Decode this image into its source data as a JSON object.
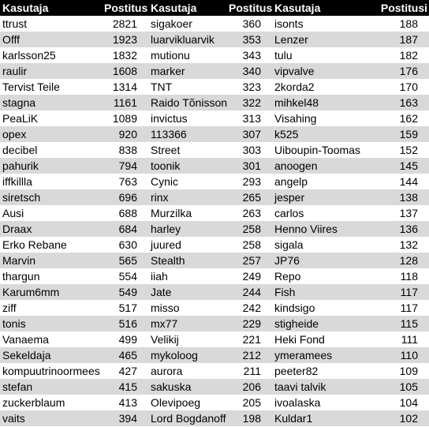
{
  "headers": [
    "Kasutaja",
    "Postitusi",
    "Kasutaja",
    "Postitusi",
    "Kasutaja",
    "Postitusi"
  ],
  "rows": [
    [
      "ttrust",
      "2821",
      "sigakoer",
      "360",
      "isonts",
      "188"
    ],
    [
      "Offf",
      "1923",
      "luarvikluarvik",
      "353",
      "Lenzer",
      "187"
    ],
    [
      "karlsson25",
      "1832",
      "mutionu",
      "343",
      "tulu",
      "182"
    ],
    [
      "raulir",
      "1608",
      "marker",
      "340",
      "vipvalve",
      "176"
    ],
    [
      "Tervist Teile",
      "1314",
      "TNT",
      "323",
      "2korda2",
      "170"
    ],
    [
      "stagna",
      "1161",
      "Raido Tõnisson",
      "322",
      "mihkel48",
      "163"
    ],
    [
      "PeaLiK",
      "1089",
      "invictus",
      "313",
      "Visahing",
      "162"
    ],
    [
      "opex",
      "920",
      "113366",
      "307",
      "k525",
      "159"
    ],
    [
      "decibel",
      "838",
      "Street",
      "303",
      "Uiboupin-Toomas",
      "152"
    ],
    [
      "pahurik",
      "794",
      "toonik",
      "301",
      "anoogen",
      "145"
    ],
    [
      "iffkillla",
      "763",
      "Cynic",
      "293",
      "angelp",
      "144"
    ],
    [
      "siretsch",
      "696",
      "rinx",
      "265",
      "jesper",
      "138"
    ],
    [
      "Ausi",
      "688",
      "Murzilka",
      "263",
      "carlos",
      "137"
    ],
    [
      "Draax",
      "684",
      "harley",
      "258",
      "Henno Viires",
      "136"
    ],
    [
      "Erko Rebane",
      "630",
      "juured",
      "258",
      "sigala",
      "132"
    ],
    [
      "Marvin",
      "565",
      "Stealth",
      "257",
      "JP76",
      "128"
    ],
    [
      "thargun",
      "554",
      "iiah",
      "249",
      "Repo",
      "118"
    ],
    [
      "Karum6mm",
      "549",
      "Jate",
      "244",
      "Fish",
      "117"
    ],
    [
      "ziff",
      "517",
      "misso",
      "242",
      "kindsigo",
      "117"
    ],
    [
      "tonis",
      "516",
      "mx77",
      "229",
      "stigheide",
      "115"
    ],
    [
      "Vanaema",
      "499",
      "Velikij",
      "221",
      "Heki Fond",
      "111"
    ],
    [
      "Sekeldaja",
      "465",
      "mykoloog",
      "212",
      "ymeramees",
      "110"
    ],
    [
      "kompuutrinoormees",
      "427",
      "aurora",
      "211",
      "peeter82",
      "109"
    ],
    [
      "stefan",
      "415",
      "sakuska",
      "206",
      "taavi talvik",
      "105"
    ],
    [
      "zuckerblaum",
      "413",
      "Olevipoeg",
      "205",
      "ivoalaska",
      "104"
    ],
    [
      "vaits",
      "394",
      "Lord Bogdanoff",
      "198",
      "Kuldar1",
      "102"
    ]
  ],
  "colors": {
    "header_bg": "#000000",
    "header_text": "#ffffff",
    "alt_row": "#d9d9d9"
  }
}
